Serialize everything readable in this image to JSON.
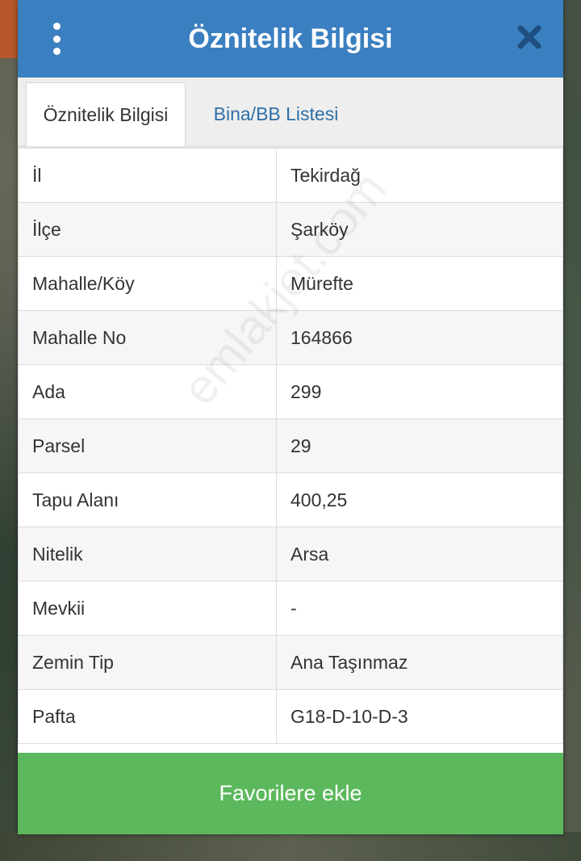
{
  "header": {
    "title": "Öznitelik Bilgisi"
  },
  "tabs": [
    {
      "label": "Öznitelik Bilgisi",
      "active": true
    },
    {
      "label": "Bina/BB Listesi",
      "active": false
    }
  ],
  "rows": [
    {
      "key": "İl",
      "value": "Tekirdağ"
    },
    {
      "key": "İlçe",
      "value": "Şarköy"
    },
    {
      "key": "Mahalle/Köy",
      "value": "Mürefte"
    },
    {
      "key": "Mahalle No",
      "value": "164866"
    },
    {
      "key": "Ada",
      "value": "299"
    },
    {
      "key": "Parsel",
      "value": "29"
    },
    {
      "key": "Tapu Alanı",
      "value": "400,25"
    },
    {
      "key": "Nitelik",
      "value": "Arsa"
    },
    {
      "key": "Mevkii",
      "value": "-"
    },
    {
      "key": "Zemin Tip",
      "value": "Ana Taşınmaz"
    },
    {
      "key": "Pafta",
      "value": "G18-D-10-D-3"
    }
  ],
  "footer": {
    "favorite_label": "Favorilere ekle"
  },
  "watermark": "emlakjet.com",
  "colors": {
    "header": "#3a7fc0",
    "tab_link": "#2e6fa7",
    "favorite_button": "#5cb85c"
  },
  "icons": {
    "menu": "vertical-dots-icon",
    "close": "close-icon"
  }
}
